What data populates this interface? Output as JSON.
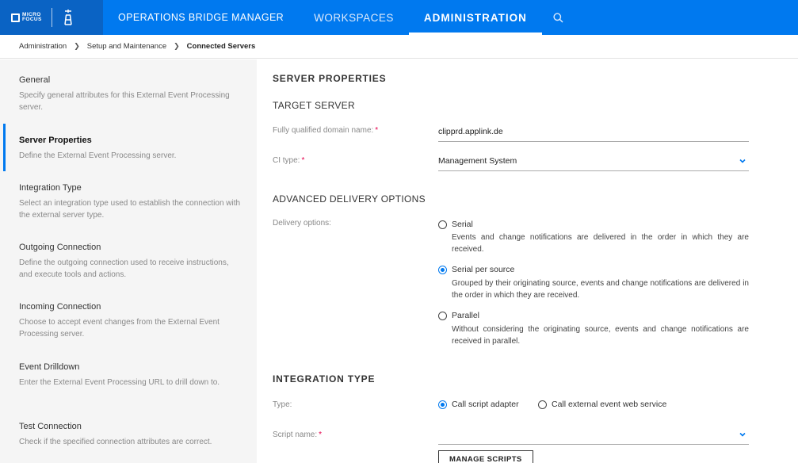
{
  "header": {
    "logo_text": [
      "MICRO",
      "FOCUS"
    ],
    "nav": [
      {
        "label": "OPERATIONS BRIDGE MANAGER"
      },
      {
        "label": "WORKSPACES"
      },
      {
        "label": "ADMINISTRATION"
      }
    ],
    "colors": {
      "bar": "#0079ef",
      "brand": "#0a63c4"
    }
  },
  "breadcrumb": [
    "Administration",
    "Setup and Maintenance",
    "Connected Servers"
  ],
  "sidebar": {
    "steps": [
      {
        "title": "General",
        "desc": "Specify general attributes for this External Event Processing server."
      },
      {
        "title": "Server Properties",
        "desc": "Define the External Event Processing server."
      },
      {
        "title": "Integration Type",
        "desc": "Select an integration type used to establish the connection with the external server type."
      },
      {
        "title": "Outgoing Connection",
        "desc": "Define the outgoing connection used to receive instructions, and execute tools and actions."
      },
      {
        "title": "Incoming Connection",
        "desc": "Choose to accept event changes from the External Event Processing server."
      },
      {
        "title": "Event Drilldown",
        "desc": "Enter the External Event Processing URL to drill down to."
      },
      {
        "title": "Test Connection",
        "desc": "Check if the specified connection attributes are correct."
      }
    ]
  },
  "main": {
    "server_properties_title": "SERVER PROPERTIES",
    "target_server_title": "TARGET SERVER",
    "fqdn_label": "Fully qualified domain name:",
    "fqdn_value": "clipprd.applink.de",
    "ci_type_label": "CI type:",
    "ci_type_value": "Management System",
    "advanced_title": "ADVANCED DELIVERY OPTIONS",
    "delivery_label": "Delivery options:",
    "delivery_options": [
      {
        "label": "Serial",
        "desc": "Events and change notifications are delivered in the order in which they are received.",
        "checked": false
      },
      {
        "label": "Serial per source",
        "desc": "Grouped by their originating source, events and change notifications are delivered in the order in which they are received.",
        "checked": true
      },
      {
        "label": "Parallel",
        "desc": "Without considering the originating source, events and change notifications are received in parallel.",
        "checked": false
      }
    ],
    "integration_title": "INTEGRATION TYPE",
    "type_label": "Type:",
    "type_options": [
      {
        "label": "Call script adapter",
        "checked": true
      },
      {
        "label": "Call external event web service",
        "checked": false
      }
    ],
    "script_label": "Script name:",
    "script_value": "",
    "manage_scripts_label": "MANAGE SCRIPTS"
  }
}
